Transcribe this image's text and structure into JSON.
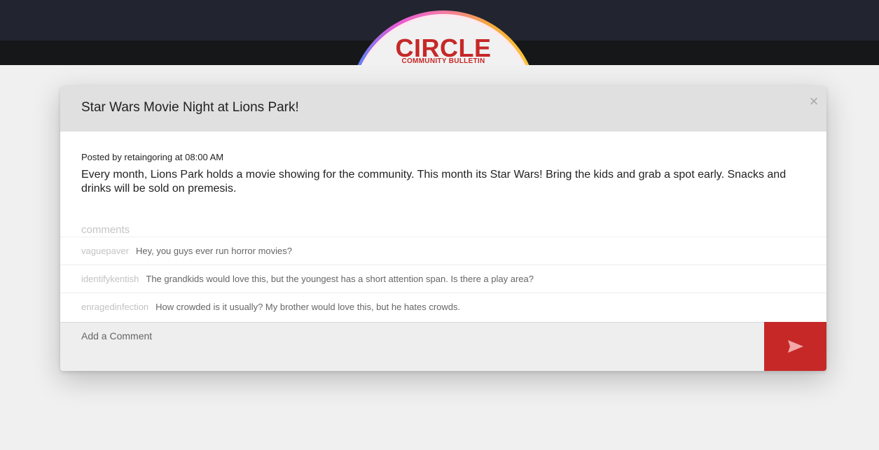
{
  "app": {
    "logo_title": "CIRCLE",
    "logo_subtitle": "COMMUNITY BULLETIN"
  },
  "post": {
    "title": "Star Wars Movie Night at Lions Park!",
    "meta": "Posted by retaingoring at 08:00 AM",
    "body": "Every month, Lions Park holds a movie showing for the community. This month its Star Wars! Bring the kids and grab a spot early. Snacks and drinks will be sold on premesis."
  },
  "comments": {
    "label": "comments",
    "items": [
      {
        "user": "vaguepaver",
        "text": "Hey, you guys ever run horror movies?"
      },
      {
        "user": "identifykentish",
        "text": "The grandkids would love this, but the youngest has a short attention span. Is there a play area?"
      },
      {
        "user": "enragedinfection",
        "text": "How crowded is it usually? My brother would love this, but he hates crowds."
      }
    ]
  },
  "compose": {
    "placeholder": "Add a Comment",
    "value": ""
  },
  "icons": {
    "close": "close-icon",
    "send": "send-icon"
  },
  "colors": {
    "accent": "#c62828",
    "topbar": "#22252f",
    "subbar": "#161719"
  }
}
